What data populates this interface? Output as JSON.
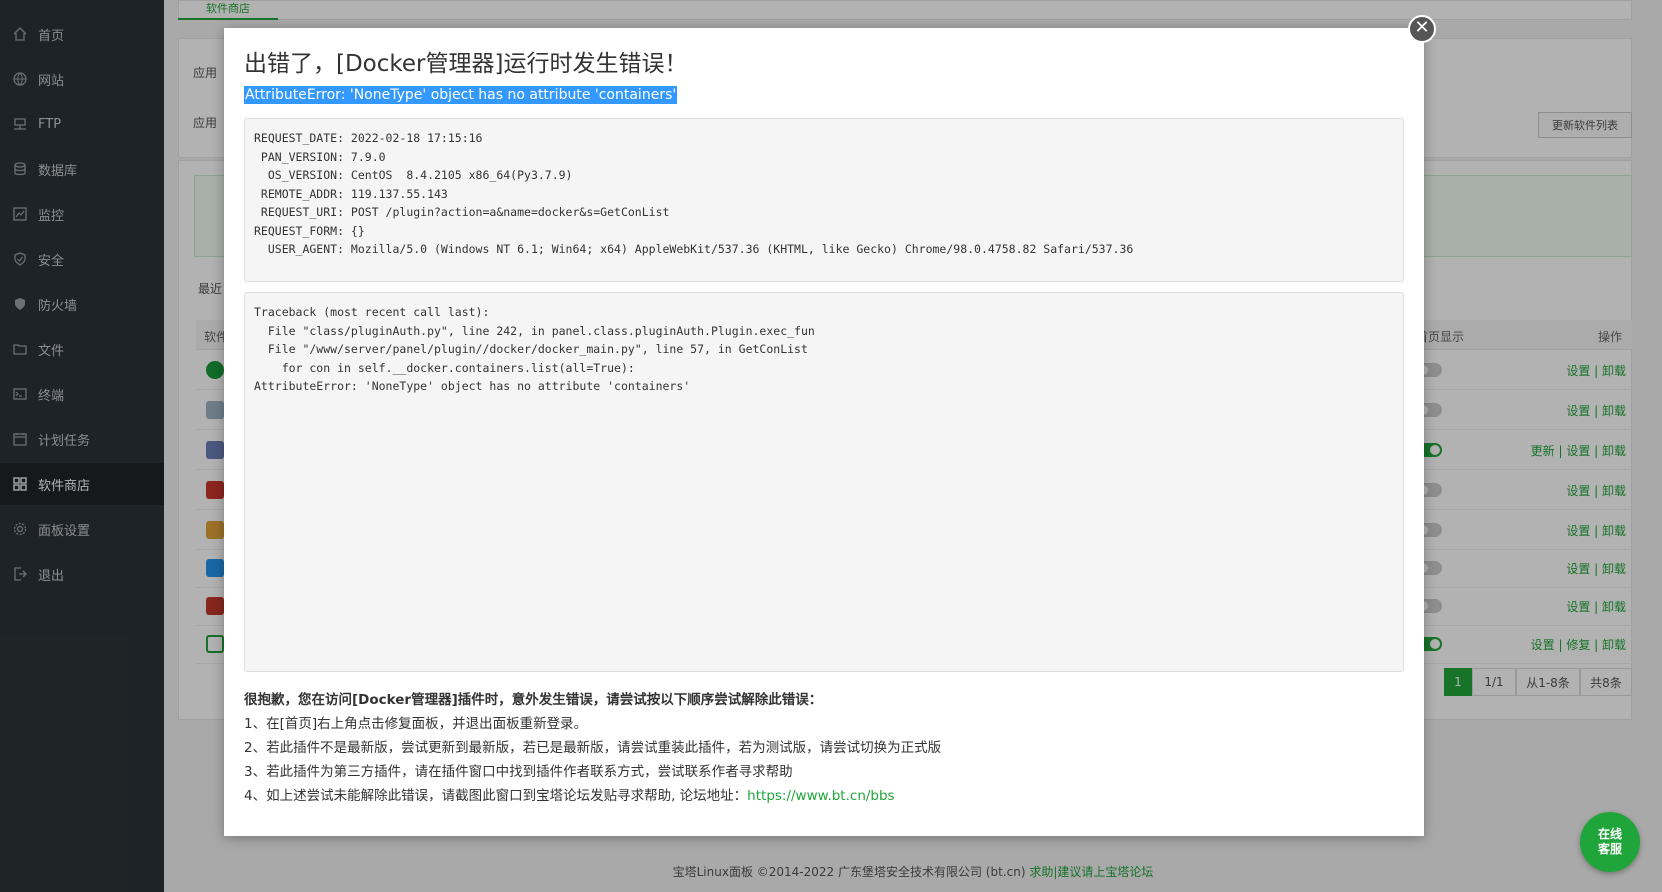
{
  "sidebar": {
    "items": [
      {
        "label": "首页",
        "icon": "home-icon"
      },
      {
        "label": "网站",
        "icon": "globe-icon"
      },
      {
        "label": "FTP",
        "icon": "ftp-icon"
      },
      {
        "label": "数据库",
        "icon": "database-icon"
      },
      {
        "label": "监控",
        "icon": "monitor-icon"
      },
      {
        "label": "安全",
        "icon": "shield-check-icon"
      },
      {
        "label": "防火墙",
        "icon": "firewall-icon"
      },
      {
        "label": "文件",
        "icon": "folder-icon"
      },
      {
        "label": "终端",
        "icon": "terminal-icon"
      },
      {
        "label": "计划任务",
        "icon": "calendar-icon"
      },
      {
        "label": "软件商店",
        "icon": "grid-icon",
        "active": true
      },
      {
        "label": "面板设置",
        "icon": "gear-icon"
      },
      {
        "label": "退出",
        "icon": "logout-icon"
      }
    ]
  },
  "background": {
    "tab_label": "软件商店",
    "label_app1": "应用",
    "label_app2": "应用",
    "label_recent": "最近",
    "update_button": "更新软件列表",
    "table": {
      "col_software": "软件",
      "col_homepage": "首页显示",
      "col_actions": "操作",
      "rows": [
        {
          "icon": "nginx-icon",
          "toggle_on": false,
          "ops": "设置 | 卸载"
        },
        {
          "icon": "mysql-icon",
          "toggle_on": false,
          "ops": "设置 | 卸载"
        },
        {
          "icon": "php-icon",
          "toggle_on": true,
          "ops": "更新 | 设置 | 卸载"
        },
        {
          "icon": "ftp-icon",
          "toggle_on": false,
          "ops": "设置 | 卸载"
        },
        {
          "icon": "ship-icon",
          "toggle_on": false,
          "ops": "设置 | 卸载"
        },
        {
          "icon": "docker-icon",
          "toggle_on": false,
          "ops": "设置 | 卸载"
        },
        {
          "icon": "redis-icon",
          "toggle_on": false,
          "ops": "设置 | 卸载"
        },
        {
          "icon": "terminal-icon",
          "toggle_on": true,
          "ops": "设置 | 修复 | 卸载"
        }
      ]
    },
    "pager": {
      "current": "1",
      "pages": "1/1",
      "range": "从1-8条",
      "total": "共8条"
    },
    "footer_text": "宝塔Linux面板 ©2014-2022 广东堡塔安全技术有限公司 (bt.cn)",
    "footer_link": "求助|建议请上宝塔论坛"
  },
  "modal": {
    "title": "出错了，[Docker管理器]运行时发生错误！",
    "error_line": "AttributeError: 'NoneType' object has no attribute 'containers'",
    "request_info": "REQUEST_DATE: 2022-02-18 17:15:16\n PAN_VERSION: 7.9.0\n  OS_VERSION: CentOS  8.4.2105 x86_64(Py3.7.9)\n REMOTE_ADDR: 119.137.55.143\n REQUEST_URI: POST /plugin?action=a&name=docker&s=GetConList\nREQUEST_FORM: {}\n  USER_AGENT: Mozilla/5.0 (Windows NT 6.1; Win64; x64) AppleWebKit/537.36 (KHTML, like Gecko) Chrome/98.0.4758.82 Safari/537.36",
    "traceback": "Traceback (most recent call last):\n  File \"class/pluginAuth.py\", line 242, in panel.class.pluginAuth.Plugin.exec_fun\n  File \"/www/server/panel/plugin//docker/docker_main.py\", line 57, in GetConList\n    for con in self.__docker.containers.list(all=True):\nAttributeError: 'NoneType' object has no attribute 'containers'",
    "help_title": "很抱歉，您在访问[Docker管理器]插件时，意外发生错误，请尝试按以下顺序尝试解除此错误：",
    "help_step1": "1、在[首页]右上角点击修复面板，并退出面板重新登录。",
    "help_step2": "2、若此插件不是最新版，尝试更新到最新版，若已是最新版，请尝试重装此插件，若为测试版，请尝试切换为正式版",
    "help_step3": "3、若此插件为第三方插件，请在插件窗口中找到插件作者联系方式，尝试联系作者寻求帮助",
    "help_step4": "4、如上述尝试未能解除此错误，请截图此窗口到宝塔论坛发贴寻求帮助, 论坛地址：",
    "help_link": "https://www.bt.cn/bbs",
    "close_symbol": "✕"
  },
  "chat": {
    "line1": "在线",
    "line2": "客服"
  }
}
